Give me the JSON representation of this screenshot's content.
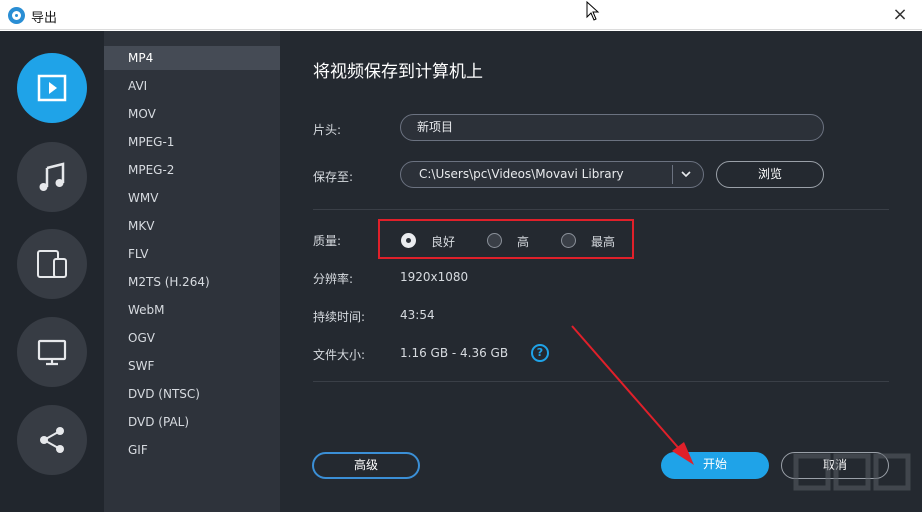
{
  "window": {
    "title": "导出",
    "close": "×"
  },
  "rail": [
    {
      "icon": "video-play-icon",
      "active": true
    },
    {
      "icon": "music-note-icon",
      "active": false
    },
    {
      "icon": "devices-icon",
      "active": false
    },
    {
      "icon": "monitor-icon",
      "active": false
    },
    {
      "icon": "share-icon",
      "active": false
    }
  ],
  "formats": [
    "MP4",
    "AVI",
    "MOV",
    "MPEG-1",
    "MPEG-2",
    "WMV",
    "MKV",
    "FLV",
    "M2TS (H.264)",
    "WebM",
    "OGV",
    "SWF",
    "DVD (NTSC)",
    "DVD (PAL)",
    "GIF"
  ],
  "selected_format": "MP4",
  "main": {
    "heading": "将视频保存到计算机上",
    "title_label": "片头:",
    "title_value": "新项目",
    "save_label": "保存至:",
    "save_path": "C:\\Users\\pc\\Videos\\Movavi Library",
    "browse": "浏览",
    "quality_label": "质量:",
    "quality_options": [
      "良好",
      "高",
      "最高"
    ],
    "quality_selected": "良好",
    "resolution_label": "分辨率:",
    "resolution": "1920x1080",
    "duration_label": "持续时间:",
    "duration": "43:54",
    "size_label": "文件大小:",
    "size": "1.16 GB - 4.36 GB",
    "help": "?",
    "advanced": "高级",
    "start": "开始",
    "cancel": "取消"
  },
  "colors": {
    "accent": "#1fa3e8",
    "highlight": "#e0202a"
  }
}
